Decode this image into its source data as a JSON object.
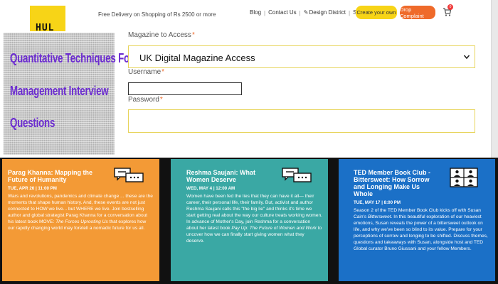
{
  "header": {
    "logo_text": "HUL",
    "free_delivery": "Free Delivery on Shopping of Rs 2500 or more",
    "nav": [
      {
        "label": "Blog"
      },
      {
        "label": "Contact Us"
      },
      {
        "label": "Design District"
      },
      {
        "label": "Signup"
      }
    ],
    "create_label": "Create your own",
    "drop_label": "Drop Complaint",
    "cart_count": "0"
  },
  "promo": {
    "lines": [
      "Quantitative Techniques For",
      "Management Interview",
      "Questions"
    ]
  },
  "form": {
    "magazine_label": "Magazine to Access",
    "magazine_value": "UK Digital Magazine Access",
    "username_label": "Username",
    "password_label": "Password",
    "required_mark": "*"
  },
  "cards": [
    {
      "color": "#f39a36",
      "title": "Parag Khanna: Mapping the Future of Humanity",
      "date": "TUE, APR 26 | 11:00 PM",
      "body_start": "Wars and revolutions, pandemics and climate change ... these are the moments that shape human history. And, these events are not just connected to HOW we live... but WHERE we live. Join bestselling author and global strategist Parag Khanna for a conversation about his latest book MOVE: ",
      "body_em": "The Forces Uprooting Us",
      "body_end": " that explores how our rapidly changing world may foretell a nomadic future for us all."
    },
    {
      "color": "#3aa8a4",
      "title": "Reshma Saujani: What Women Deserve",
      "date": "WED, MAY 4 | 12:00 AM",
      "body_start": "Women have been fed the lies that they can have it all— their career, their personal life, their family. But, activist and author Reshma Saujani calls this \"the big lie\" and thinks it's time we start getting real about the way our culture treats working women. In advance of Mother's Day, join Reshma for a conversation about her latest book ",
      "body_em": "Pay Up: The Future of Women and Work",
      "body_end": " to uncover how we can finally start giving women what they deserve."
    },
    {
      "color": "#1b70c7",
      "title": "TED Member Book Club - Bittersweet: How Sorrow and Longing Make Us Whole",
      "date": "TUE, MAY 17 | 8:00 PM",
      "body_start": "Season 2 of the TED Member Book Club kicks off with Susan Cain's ",
      "body_em": "Bittersweet",
      "body_end": ". In this beautiful exploration of our heaviest emotions, Susan reveals the power of a bittersweet outlook on life, and why we've been so blind to its value. Prepare for your perceptions of sorrow and longing to be shifted. Discuss themes, questions and takeaways with Susan, alongside host and TED Global curator Bruno Giussani and your fellow Members."
    }
  ],
  "icons": {
    "chat": "chat-bubbles-icon",
    "video": "video-call-icon",
    "pen": "pen-icon",
    "cart": "cart-icon",
    "chevron": "chevron-down-icon"
  }
}
